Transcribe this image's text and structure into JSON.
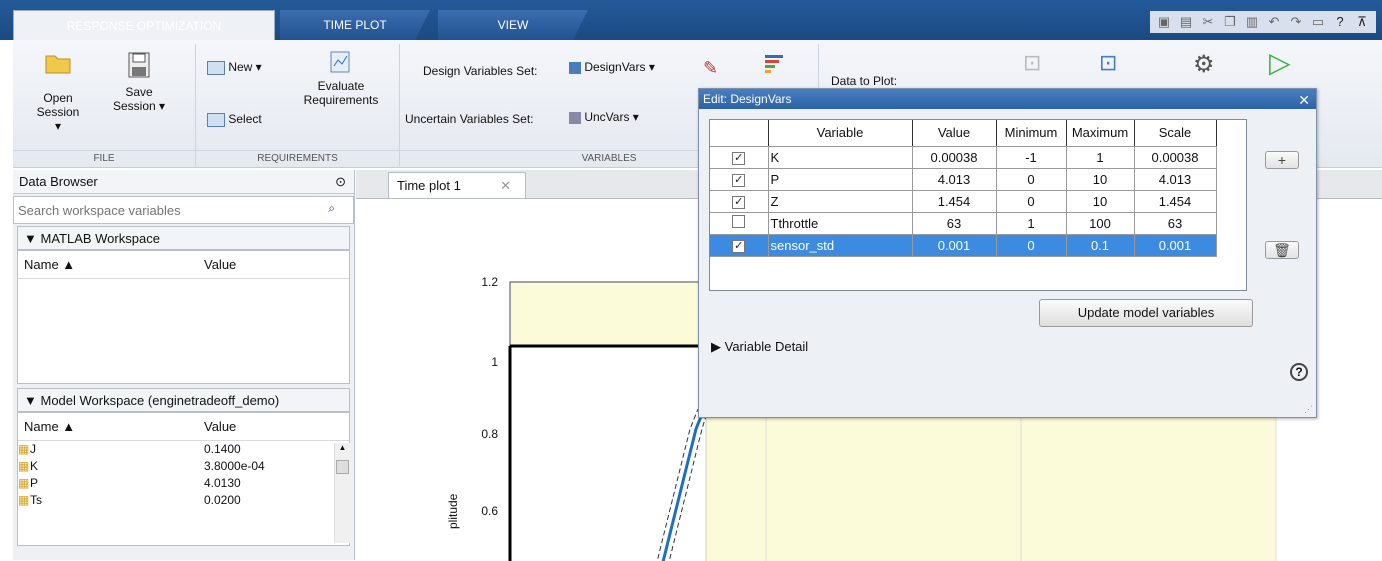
{
  "tabs": {
    "response_optimization": "RESPONSE OPTIMIZATION",
    "time_plot": "TIME PLOT",
    "view": "VIEW"
  },
  "ribbon": {
    "open_session": [
      "Open",
      "Session ▾"
    ],
    "save_session": [
      "Save",
      "Session ▾"
    ],
    "new": "New ▾",
    "select": "Select",
    "evaluate": [
      "Evaluate",
      "Requirements"
    ],
    "design_vars_label": "Design Variables Set:",
    "design_vars_value": "DesignVars ▾",
    "uncertain_vars_label": "Uncertain Variables Set:",
    "uncertain_vars_value": "UncVars ▾",
    "data_to_plot": "Data to Plot:",
    "sections": {
      "file": "FILE",
      "requirements": "REQUIREMENTS",
      "variables": "VARIABLES"
    }
  },
  "browser": {
    "title": "Data Browser",
    "search_placeholder": "Search workspace variables",
    "matlab_ws": "MATLAB Workspace",
    "model_ws": "Model Workspace (enginetradeoff_demo)",
    "col_name": "Name ▲",
    "col_value": "Value",
    "vars": [
      {
        "name": "J",
        "value": "0.1400"
      },
      {
        "name": "K",
        "value": "3.8000e-04"
      },
      {
        "name": "P",
        "value": "4.0130"
      },
      {
        "name": "Ts",
        "value": "0.0200"
      }
    ]
  },
  "plot": {
    "tab": "Time plot 1",
    "ylabel": "plitude",
    "yticks": [
      "1.2",
      "1",
      "0.8",
      "0.6"
    ]
  },
  "dialog": {
    "title": "Edit: DesignVars",
    "headers": [
      "Variable",
      "Value",
      "Minimum",
      "Maximum",
      "Scale"
    ],
    "rows": [
      {
        "checked": true,
        "v": "K",
        "val": "0.00038",
        "min": "-1",
        "max": "1",
        "scale": "0.00038"
      },
      {
        "checked": true,
        "v": "P",
        "val": "4.013",
        "min": "0",
        "max": "10",
        "scale": "4.013"
      },
      {
        "checked": true,
        "v": "Z",
        "val": "1.454",
        "min": "0",
        "max": "10",
        "scale": "1.454"
      },
      {
        "checked": false,
        "v": "Tthrottle",
        "val": "63",
        "min": "1",
        "max": "100",
        "scale": "63"
      },
      {
        "checked": true,
        "v": "sensor_std",
        "val": "0.001",
        "min": "0",
        "max": "0.1",
        "scale": "0.001",
        "selected": true
      }
    ],
    "update_button": "Update model variables",
    "variable_detail": "Variable Detail"
  }
}
